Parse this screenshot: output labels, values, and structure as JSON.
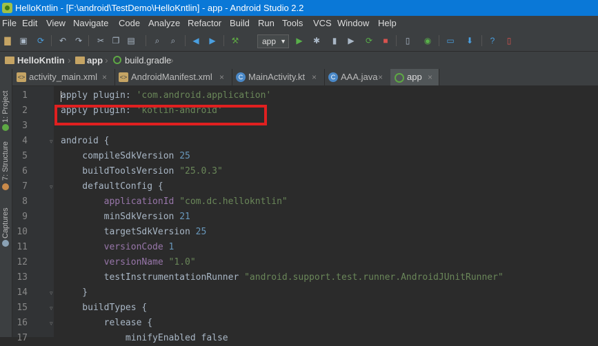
{
  "window": {
    "title": "HelloKntlin - [F:\\android\\TestDemo\\HelloKntlin] - app - Android Studio 2.2"
  },
  "menu": {
    "items": [
      "File",
      "Edit",
      "View",
      "Navigate",
      "Code",
      "Analyze",
      "Refactor",
      "Build",
      "Run",
      "Tools",
      "VCS",
      "Window",
      "Help"
    ]
  },
  "toolbar": {
    "run_config": "app"
  },
  "breadcrumb": {
    "items": [
      "HelloKntlin",
      "app",
      "build.gradle"
    ]
  },
  "tabs": [
    {
      "label": "activity_main.xml",
      "icon": "xml-file-icon",
      "close": "×"
    },
    {
      "label": "AndroidManifest.xml",
      "icon": "manifest-file-icon",
      "close": "×"
    },
    {
      "label": "MainActivity.kt",
      "icon": "kotlin-class-icon",
      "close": "×"
    },
    {
      "label": "AAA.java",
      "icon": "java-class-icon",
      "close": "×"
    },
    {
      "label": "app",
      "icon": "gradle-icon",
      "close": "×"
    }
  ],
  "side_tabs": [
    "1: Project",
    "7: Structure",
    "Captures"
  ],
  "editor": {
    "line_numbers": [
      "1",
      "2",
      "3",
      "4",
      "5",
      "6",
      "7",
      "8",
      "9",
      "10",
      "11",
      "12",
      "13",
      "14",
      "15",
      "16",
      "17"
    ],
    "lines": [
      [
        {
          "t": "apply plugin: ",
          "c": "kw"
        },
        {
          "t": "'com.android.application'",
          "c": "str"
        }
      ],
      [
        {
          "t": "apply plugin: ",
          "c": "kw"
        },
        {
          "t": "'kotlin-android'",
          "c": "str"
        }
      ],
      [],
      [
        {
          "t": "android {",
          "c": "kw"
        }
      ],
      [
        {
          "t": "    compileSdkVersion ",
          "c": "kw"
        },
        {
          "t": "25",
          "c": "num"
        }
      ],
      [
        {
          "t": "    buildToolsVersion ",
          "c": "kw"
        },
        {
          "t": "\"25.0.3\"",
          "c": "str"
        }
      ],
      [
        {
          "t": "    defaultConfig {",
          "c": "kw"
        }
      ],
      [
        {
          "t": "        applicationId ",
          "c": "prop"
        },
        {
          "t": "\"com.dc.hellokntlin\"",
          "c": "str"
        }
      ],
      [
        {
          "t": "        minSdkVersion ",
          "c": "kw"
        },
        {
          "t": "21",
          "c": "num"
        }
      ],
      [
        {
          "t": "        targetSdkVersion ",
          "c": "kw"
        },
        {
          "t": "25",
          "c": "num"
        }
      ],
      [
        {
          "t": "        versionCode ",
          "c": "prop"
        },
        {
          "t": "1",
          "c": "num"
        }
      ],
      [
        {
          "t": "        versionName ",
          "c": "prop"
        },
        {
          "t": "\"1.0\"",
          "c": "str"
        }
      ],
      [
        {
          "t": "        testInstrumentationRunner ",
          "c": "kw"
        },
        {
          "t": "\"android.support.test.runner.AndroidJUnitRunner\"",
          "c": "str"
        }
      ],
      [
        {
          "t": "    }",
          "c": "kw"
        }
      ],
      [
        {
          "t": "    buildTypes {",
          "c": "kw"
        }
      ],
      [
        {
          "t": "        release {",
          "c": "kw"
        }
      ],
      [
        {
          "t": "            minifyEnabled false",
          "c": "kw"
        }
      ]
    ]
  },
  "colors": {
    "title_bar": "#0a78d7",
    "chrome": "#3c3f41",
    "editor_bg": "#2b2b2b",
    "string": "#6a8759",
    "number": "#6897bb",
    "property": "#9876aa",
    "highlight_box": "#e02020"
  }
}
